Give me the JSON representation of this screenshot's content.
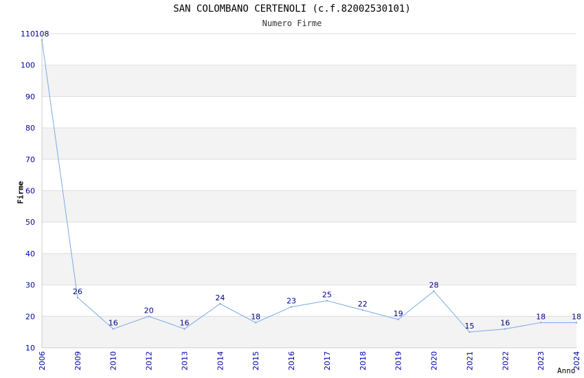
{
  "chart_data": {
    "type": "line",
    "title": "SAN COLOMBANO CERTENOLI (c.f.82002530101)",
    "subtitle": "Numero Firme",
    "xlabel": "Anno",
    "ylabel": "Firme",
    "categories": [
      "2006",
      "2009",
      "2010",
      "2012",
      "2013",
      "2014",
      "2015",
      "2016",
      "2017",
      "2018",
      "2019",
      "2020",
      "2021",
      "2022",
      "2023",
      "2024"
    ],
    "series": [
      {
        "values": [
          108,
          26,
          16,
          20,
          16,
          24,
          18,
          23,
          25,
          22,
          19,
          28,
          15,
          16,
          18,
          18
        ]
      }
    ],
    "yticks": [
      10,
      20,
      30,
      40,
      50,
      60,
      70,
      80,
      90,
      100,
      110
    ],
    "ylim": [
      10,
      110
    ],
    "grid": true,
    "colors": {
      "line": "#7aa9e6",
      "band_alt": "#f3f3f3",
      "band": "#ffffff",
      "gridline": "#dddddd",
      "tick_label": "#0000aa",
      "data_label": "#000080"
    }
  }
}
